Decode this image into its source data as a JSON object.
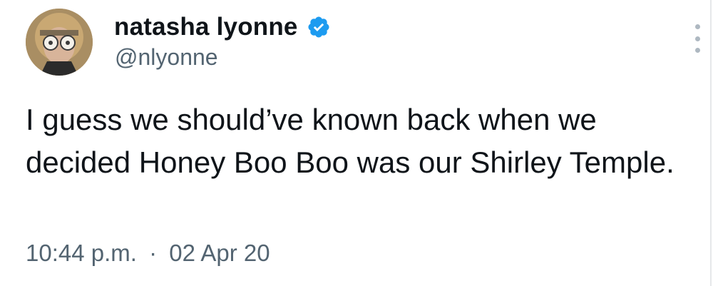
{
  "author": {
    "display_name": "natasha lyonne",
    "handle": "@nlyonne",
    "verified": true,
    "avatar_icon": "profile-avatar"
  },
  "tweet": {
    "text": "I guess we should’ve known back when we decided Honey Boo Boo was our Shirley Temple.",
    "time": "10:44 p.m.",
    "separator": "·",
    "date": "02 Apr 20"
  },
  "icons": {
    "verified": "verified-badge-icon",
    "more": "more-options-icon"
  },
  "colors": {
    "text_primary": "#0f1419",
    "text_secondary": "#536471",
    "verified_blue": "#1d9bf0",
    "background": "#ffffff"
  }
}
